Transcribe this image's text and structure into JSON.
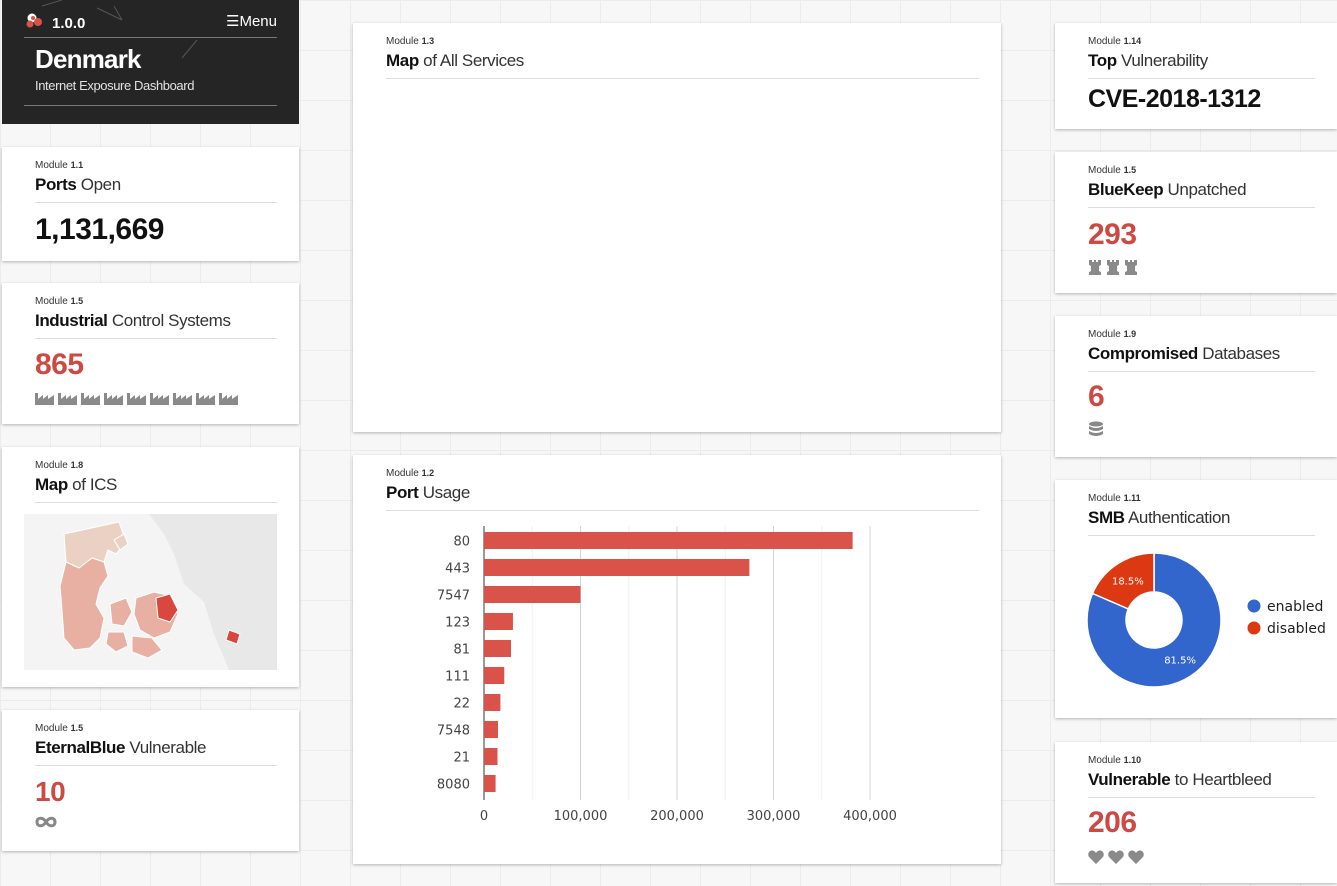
{
  "header": {
    "version": "1.0.0",
    "menu_label": "Menu",
    "country": "Denmark",
    "subtitle": "Internet Exposure Dashboard"
  },
  "modules": {
    "ports_open": {
      "module_prefix": "Module",
      "module_no": "1.1",
      "title_strong": "Ports",
      "title_rest": " Open",
      "value": "1,131,669"
    },
    "ics": {
      "module_prefix": "Module",
      "module_no": "1.5",
      "title_strong": "Industrial",
      "title_rest": " Control Systems",
      "value": "865",
      "icon": "factory-icon",
      "icon_count": 9
    },
    "map_ics": {
      "module_prefix": "Module",
      "module_no": "1.8",
      "title_strong": "Map",
      "title_rest": " of ICS"
    },
    "eternalblue": {
      "module_prefix": "Module",
      "module_no": "1.5",
      "title_strong": "EternalBlue",
      "title_rest": " Vulnerable",
      "value": "10",
      "icon": "infinity-icon"
    },
    "map_services": {
      "module_prefix": "Module",
      "module_no": "1.3",
      "title_strong": "Map",
      "title_rest": " of All Services"
    },
    "port_usage": {
      "module_prefix": "Module",
      "module_no": "1.2",
      "title_strong": "Port",
      "title_rest": " Usage"
    },
    "top_vuln": {
      "module_prefix": "Module",
      "module_no": "1.14",
      "title_strong": "Top",
      "title_rest": " Vulnerability",
      "value": "CVE-2018-1312"
    },
    "bluekeep": {
      "module_prefix": "Module",
      "module_no": "1.5",
      "title_strong": "BlueKeep",
      "title_rest": " Unpatched",
      "value": "293",
      "icon": "rook-icon",
      "icon_count": 3
    },
    "compromised_db": {
      "module_prefix": "Module",
      "module_no": "1.9",
      "title_strong": "Compromised",
      "title_rest": " Databases",
      "value": "6",
      "icon": "database-icon"
    },
    "smb": {
      "module_prefix": "Module",
      "module_no": "1.11",
      "title_strong": "SMB",
      "title_rest": " Authentication"
    },
    "heartbleed": {
      "module_prefix": "Module",
      "module_no": "1.10",
      "title_strong": "Vulnerable",
      "title_rest": " to Heartbleed",
      "value": "206",
      "icon": "heart-icon",
      "icon_count": 3
    }
  },
  "colors": {
    "accent_red": "#cc4a43",
    "bar_red": "#d9534a",
    "donut_blue": "#3366cc",
    "donut_red": "#dc3912",
    "map_land": "#ebd1c4",
    "map_ics": "#e8b0a3",
    "map_highlight": "#d9483f"
  },
  "chart_data": [
    {
      "type": "bar",
      "orientation": "horizontal",
      "categories": [
        "80",
        "443",
        "7547",
        "123",
        "81",
        "111",
        "22",
        "7548",
        "21",
        "8080"
      ],
      "values": [
        382000,
        275000,
        100000,
        30000,
        28000,
        21000,
        17000,
        14500,
        14000,
        12000
      ],
      "xlim": [
        0,
        400000
      ],
      "x_ticks": [
        "0",
        "100,000",
        "200,000",
        "300,000",
        "400,000"
      ],
      "x_tick_values": [
        0,
        100000,
        200000,
        300000,
        400000
      ],
      "grid": true,
      "title": "",
      "xlabel": "",
      "ylabel": ""
    },
    {
      "type": "pie",
      "variant": "donut",
      "labels": [
        "enabled",
        "disabled"
      ],
      "values": [
        81.5,
        18.5
      ],
      "value_labels": [
        "81.5%",
        "18.5%"
      ],
      "colors": [
        "#3366cc",
        "#dc3912"
      ],
      "legend_position": "right"
    }
  ]
}
